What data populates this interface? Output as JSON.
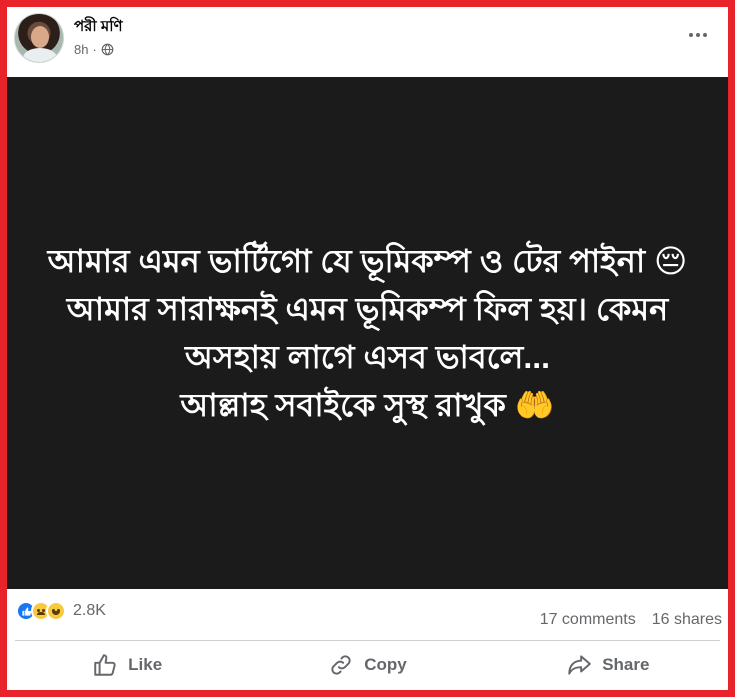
{
  "post": {
    "author": "পরী মণি",
    "time": "8h",
    "separator": "·",
    "text_lines": [
      "আমার এমন ভার্টিগো যে ভূমিকম্প ও টের পাইনা 😔",
      "আমার সারাক্ষনই এমন ভূমিকম্প ফিল হয়। কেমন",
      "অসহায় লাগে এসব ভাবলে...",
      "আল্লাহ সবাইকে সুস্থ রাখুক 🤲"
    ]
  },
  "stats": {
    "reaction_icons": [
      "like-icon",
      "sad-icon",
      "haha-icon"
    ],
    "reactions": "2.8K",
    "comments": "17 comments",
    "shares": "16 shares"
  },
  "actions": {
    "like": "Like",
    "copy": "Copy",
    "share": "Share"
  },
  "colors": {
    "frame": "#e8232c",
    "post_background": "#1b1b1c",
    "muted_text": "#65676b",
    "like_blue": "#1877f2"
  }
}
